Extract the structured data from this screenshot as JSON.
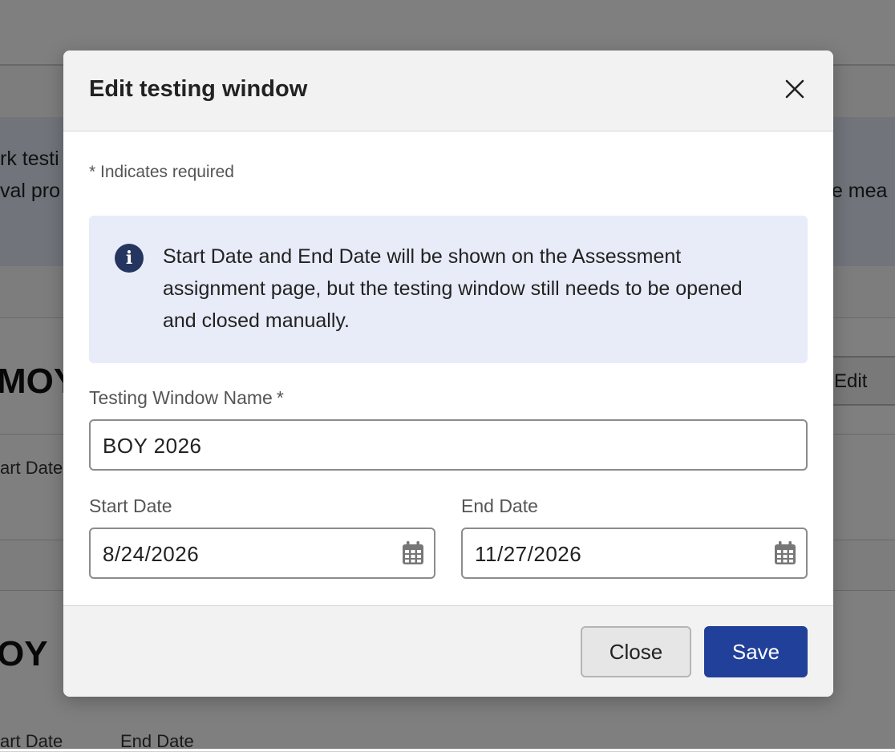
{
  "background": {
    "banner_line1": "rk testi",
    "banner_line2": "val pro",
    "banner_right": "te mea",
    "card1_title": "MOY",
    "card1_start_label": "art Date",
    "edit_label": "Edit",
    "card2_title": "OY",
    "card2_start_label": "art Date",
    "card2_end_label": "End Date"
  },
  "modal": {
    "title": "Edit testing window",
    "close_icon": "close-icon",
    "required_note": "* Indicates required",
    "info": {
      "icon": "info-icon",
      "icon_glyph": "i",
      "text": "Start Date and End Date will be shown on the Assessment assignment page, but the testing window still needs to be opened and closed manually."
    },
    "fields": {
      "name": {
        "label": "Testing Window Name",
        "required_marker": "*",
        "value": "BOY 2026"
      },
      "start_date": {
        "label": "Start Date",
        "value": "8/24/2026",
        "icon": "calendar-icon"
      },
      "end_date": {
        "label": "End Date",
        "value": "11/27/2026",
        "icon": "calendar-icon"
      }
    },
    "footer": {
      "close_label": "Close",
      "save_label": "Save"
    }
  },
  "colors": {
    "primary": "#21409a",
    "info_bg": "#e8ecf8",
    "info_icon": "#24365f",
    "overlay": "rgba(0,0,0,0.5)"
  }
}
